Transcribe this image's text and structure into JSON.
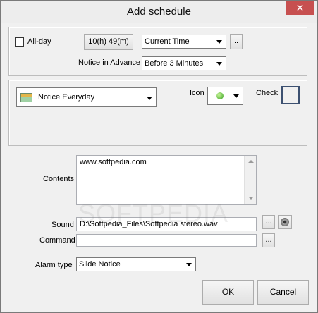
{
  "window": {
    "title": "Add schedule"
  },
  "time_group": {
    "allday_label": "All-day",
    "allday_checked": false,
    "time_button": "10(h) 49(m)",
    "time_mode": "Current Time",
    "browse_label": "..",
    "notice_label": "Notice in Advance",
    "notice_value": "Before 3 Minutes"
  },
  "repeat_group": {
    "repeat_value": "Notice Everyday",
    "icon_label": "Icon",
    "check_label": "Check"
  },
  "contents": {
    "label": "Contents",
    "text": "www.softpedia.com"
  },
  "sound": {
    "label": "Sound",
    "path": "D:\\Softpedia_Files\\Softpedia stereo.wav",
    "browse_label": "..."
  },
  "command": {
    "label": "Command",
    "value": "",
    "browse_label": "..."
  },
  "alarm": {
    "label": "Alarm type",
    "value": "Slide Notice"
  },
  "footer": {
    "ok_label": "OK",
    "cancel_label": "Cancel"
  },
  "watermark": "SOFTPEDIA"
}
